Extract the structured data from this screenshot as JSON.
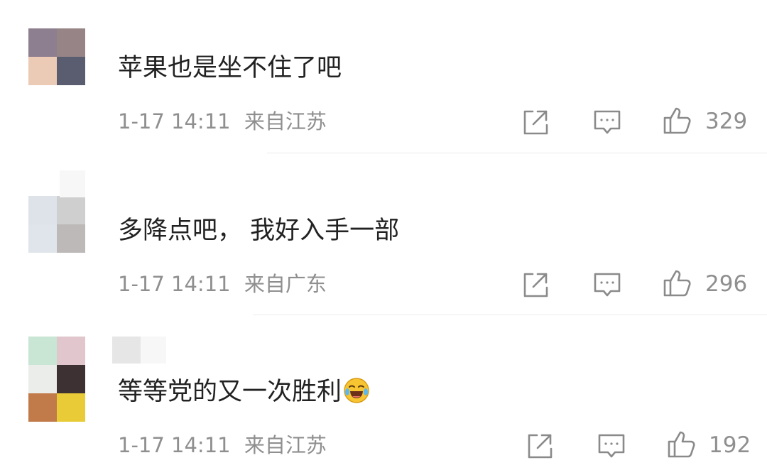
{
  "comments": [
    {
      "text": "苹果也是坐不住了吧",
      "time": "1-17 14:11",
      "location": "来自江苏",
      "likes": "329",
      "avatar_colors": [
        "#8d7f8f",
        "#968486",
        "#eccbb6",
        "#5a5c70"
      ]
    },
    {
      "text": "多降点吧， 我好入手一部",
      "time": "1-17 14:11",
      "location": "来自广东",
      "likes": "296",
      "avatar_colors": [
        "#dde3e8",
        "#d0cfcf",
        "#dfe5ea",
        "#bdb9b9"
      ]
    },
    {
      "text": "等等党的又一次胜利",
      "time": "1-17 14:11",
      "location": "来自江苏",
      "likes": "192",
      "avatar_colors": [
        "#c9e6d4",
        "#e2c6cd",
        "#ebedeb",
        "#3e3134",
        "#c17a4a",
        "#e8cb37"
      ],
      "emoji": "laughing-crying-emoji"
    }
  ],
  "icons": {
    "share": "share-icon",
    "comment": "comment-icon",
    "like": "thumbs-up-icon"
  },
  "colors": {
    "text": "#222222",
    "meta": "#8f8f8f",
    "icon": "#8a8a8a",
    "divider": "#ececec"
  }
}
